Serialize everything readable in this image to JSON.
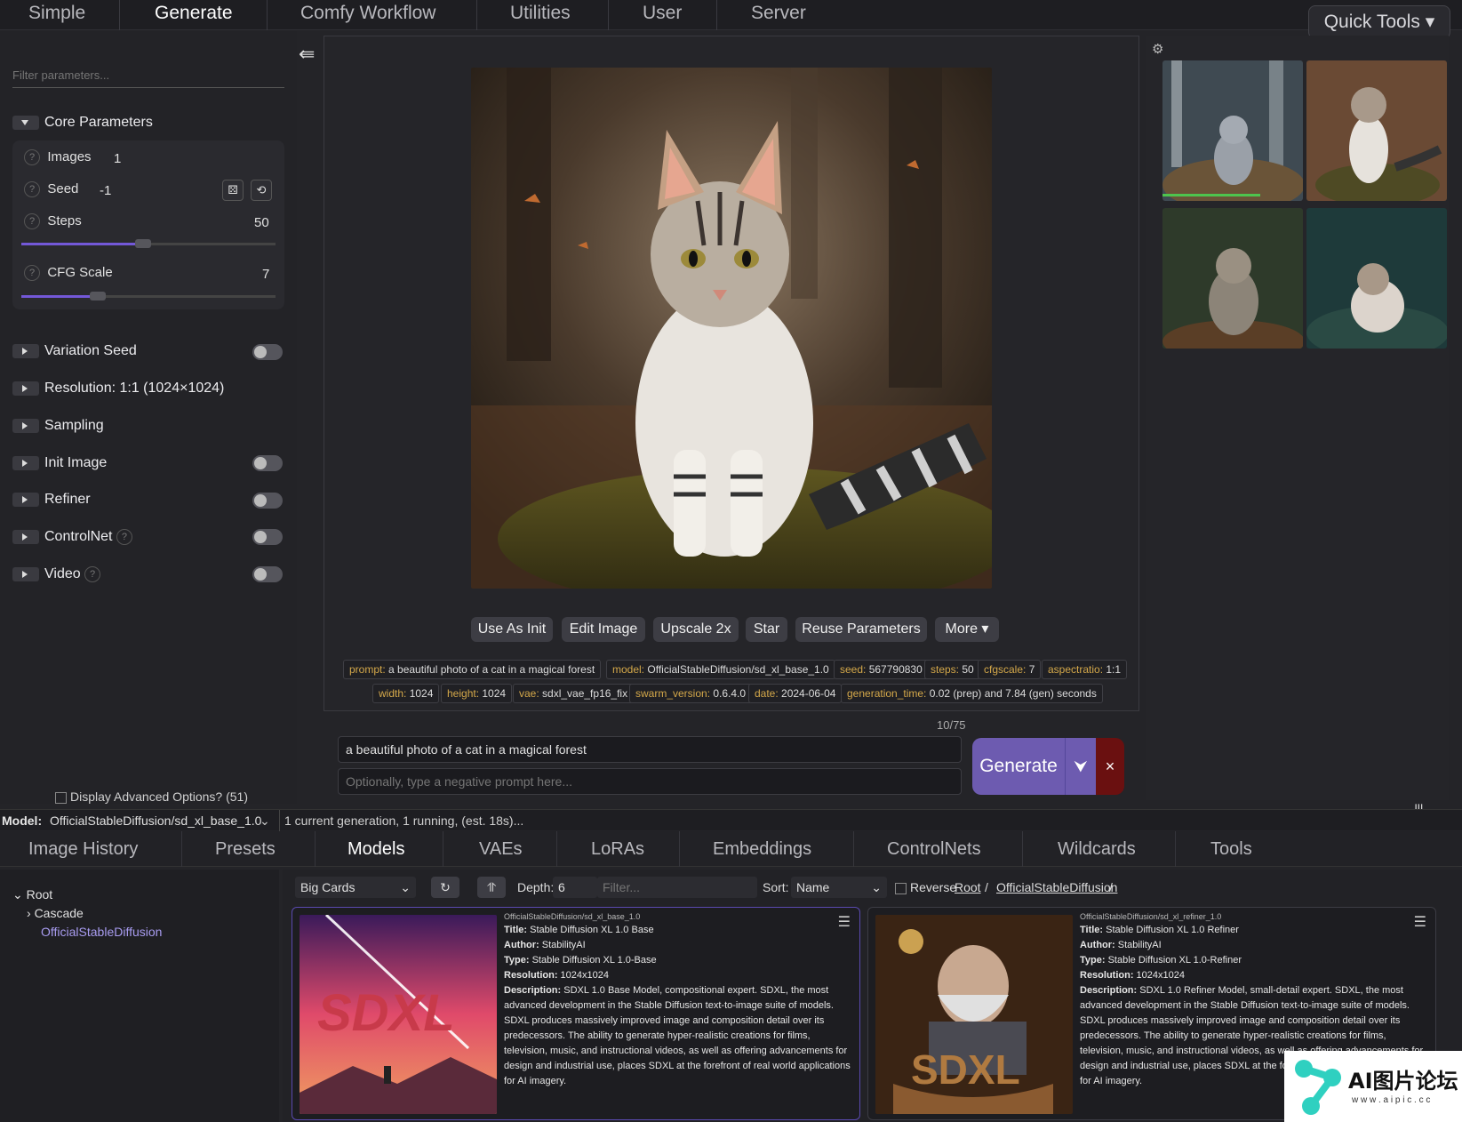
{
  "topnav": {
    "tabs": [
      "Simple",
      "Generate",
      "Comfy Workflow",
      "Utilities",
      "User",
      "Server"
    ],
    "active": "Generate",
    "quick_tools": "Quick Tools ▾"
  },
  "left": {
    "filter_placeholder": "Filter parameters...",
    "core_params": "Core Parameters",
    "images_label": "Images",
    "images_value": "1",
    "seed_label": "Seed",
    "seed_value": "-1",
    "steps_label": "Steps",
    "steps_value": "50",
    "steps_fraction": 0.48,
    "cfg_label": "CFG Scale",
    "cfg_value": "7",
    "cfg_fraction": 0.3,
    "groups": {
      "variation_seed": "Variation Seed",
      "resolution": "Resolution: 1:1 (1024×1024)",
      "sampling": "Sampling",
      "init_image": "Init Image",
      "refiner": "Refiner",
      "controlnet": "ControlNet",
      "video": "Video"
    },
    "advanced": "Display Advanced Options? (51)"
  },
  "actions": [
    "Use As Init",
    "Edit Image",
    "Upscale 2x",
    "Star",
    "Reuse Parameters",
    "More ▾"
  ],
  "tags": {
    "row1": [
      {
        "k": "prompt:",
        "v": " a beautiful photo of a cat in a magical forest"
      },
      {
        "k": "model:",
        "v": " OfficialStableDiffusion/sd_xl_base_1.0"
      },
      {
        "k": "seed:",
        "v": " 567790830"
      },
      {
        "k": "steps:",
        "v": " 50"
      },
      {
        "k": "cfgscale:",
        "v": " 7"
      },
      {
        "k": "aspectratio:",
        "v": " 1:1"
      }
    ],
    "row2": [
      {
        "k": "width:",
        "v": " 1024"
      },
      {
        "k": "height:",
        "v": " 1024"
      },
      {
        "k": "vae:",
        "v": " sdxl_vae_fp16_fix"
      },
      {
        "k": "swarm_version:",
        "v": " 0.6.4.0"
      },
      {
        "k": "date:",
        "v": " 2024-06-04"
      },
      {
        "k": "generation_time:",
        "v": " 0.02 (prep) and 7.84 (gen) seconds"
      }
    ]
  },
  "prompt": {
    "counter": "10/75",
    "positive": "a beautiful photo of a cat in a magical forest",
    "negative_placeholder": "Optionally, type a negative prompt here...",
    "generate": "Generate",
    "drop": "⮟",
    "stop": "×"
  },
  "status": {
    "model_label": "Model:",
    "model_value": "OfficialStableDiffusion/sd_xl_base_1.0",
    "status_text": "1 current generation, 1 running, (est. 18s)..."
  },
  "bottomtabs": [
    "Image History",
    "Presets",
    "Models",
    "VAEs",
    "LoRAs",
    "Embeddings",
    "ControlNets",
    "Wildcards",
    "Tools"
  ],
  "tree": {
    "root": "Root",
    "cascade": "Cascade",
    "official": "OfficialStableDiffusion"
  },
  "browser": {
    "view": "Big Cards",
    "depth_label": "Depth:",
    "depth_value": "6",
    "filter_placeholder": "Filter...",
    "sort_label": "Sort:",
    "sort_value": "Name",
    "reverse": "Reverse",
    "path_root": "Root",
    "path_sep": " / ",
    "path_folder": "OfficialStableDiffusion",
    "path_end": " /"
  },
  "cards": [
    {
      "file": "OfficialStableDiffusion/sd_xl_base_1.0",
      "title_k": "Title:",
      "title": " Stable Diffusion XL 1.0 Base",
      "author_k": "Author:",
      "author": " StabilityAI",
      "type_k": "Type:",
      "type": " Stable Diffusion XL 1.0-Base",
      "res_k": "Resolution:",
      "res": " 1024x1024",
      "desc_k": "Description:",
      "desc": " SDXL 1.0 Base Model, compositional expert. SDXL, the most advanced development in the Stable Diffusion text-to-image suite of models. SDXL produces massively improved image and composition detail over its predecessors. The ability to generate hyper-realistic creations for films, television, music, and instructional videos, as well as offering advancements for design and industrial use, places SDXL at the forefront of real world applications for AI imagery.",
      "logo": "SDXL"
    },
    {
      "file": "OfficialStableDiffusion/sd_xl_refiner_1.0",
      "title_k": "Title:",
      "title": " Stable Diffusion XL 1.0 Refiner",
      "author_k": "Author:",
      "author": " StabilityAI",
      "type_k": "Type:",
      "type": " Stable Diffusion XL 1.0-Refiner",
      "res_k": "Resolution:",
      "res": " 1024x1024",
      "desc_k": "Description:",
      "desc": " SDXL 1.0 Refiner Model, small-detail expert. SDXL, the most advanced development in the Stable Diffusion text-to-image suite of models. SDXL produces massively improved image and composition detail over its predecessors. The ability to generate hyper-realistic creations for films, television, music, and instructional videos, as well as offering advancements for design and industrial use, places SDXL at the forefront of real world applications for AI imagery.",
      "logo": "SDXL"
    }
  ],
  "watermark": {
    "text": "AI图片论坛",
    "sub": "w w w . a i p i c . c c"
  },
  "colors": {
    "accent": "#6d5bb0",
    "stop": "#6a1010",
    "tag_key": "#d4a84a",
    "link": "#a89cf0"
  }
}
